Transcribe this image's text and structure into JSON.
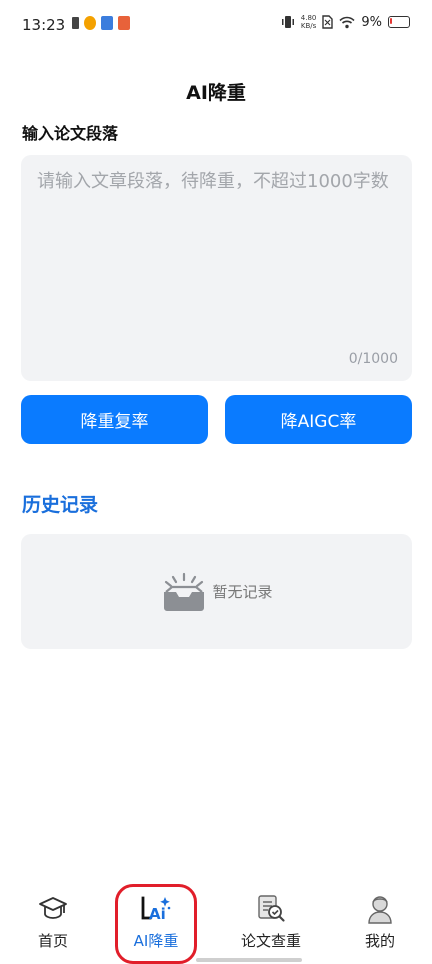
{
  "status_bar": {
    "time": "13:23",
    "net_speed_value": "4.80",
    "net_speed_unit": "KB/s",
    "battery": "9%"
  },
  "page": {
    "title": "AI降重",
    "input_section_label": "输入论文段落"
  },
  "editor": {
    "placeholder": "请输入文章段落，待降重，不超过1000字数",
    "value": "",
    "char_count": "0/1000"
  },
  "actions": {
    "reduce_repetition_label": "降重复率",
    "reduce_aigc_label": "降AIGC率"
  },
  "history": {
    "title": "历史记录",
    "empty_text": "暂无记录"
  },
  "tabs": [
    {
      "label": "首页",
      "icon": "graduation-cap-icon",
      "active": false
    },
    {
      "label": "AI降重",
      "icon": "ai-sparkle-icon",
      "active": true
    },
    {
      "label": "论文查重",
      "icon": "document-check-icon",
      "active": false
    },
    {
      "label": "我的",
      "icon": "user-avatar-icon",
      "active": false
    }
  ],
  "colors": {
    "primary": "#0a7bff",
    "accent_text": "#1a6fdc",
    "panel_bg": "#f2f3f5",
    "highlight": "#e11e2a"
  }
}
